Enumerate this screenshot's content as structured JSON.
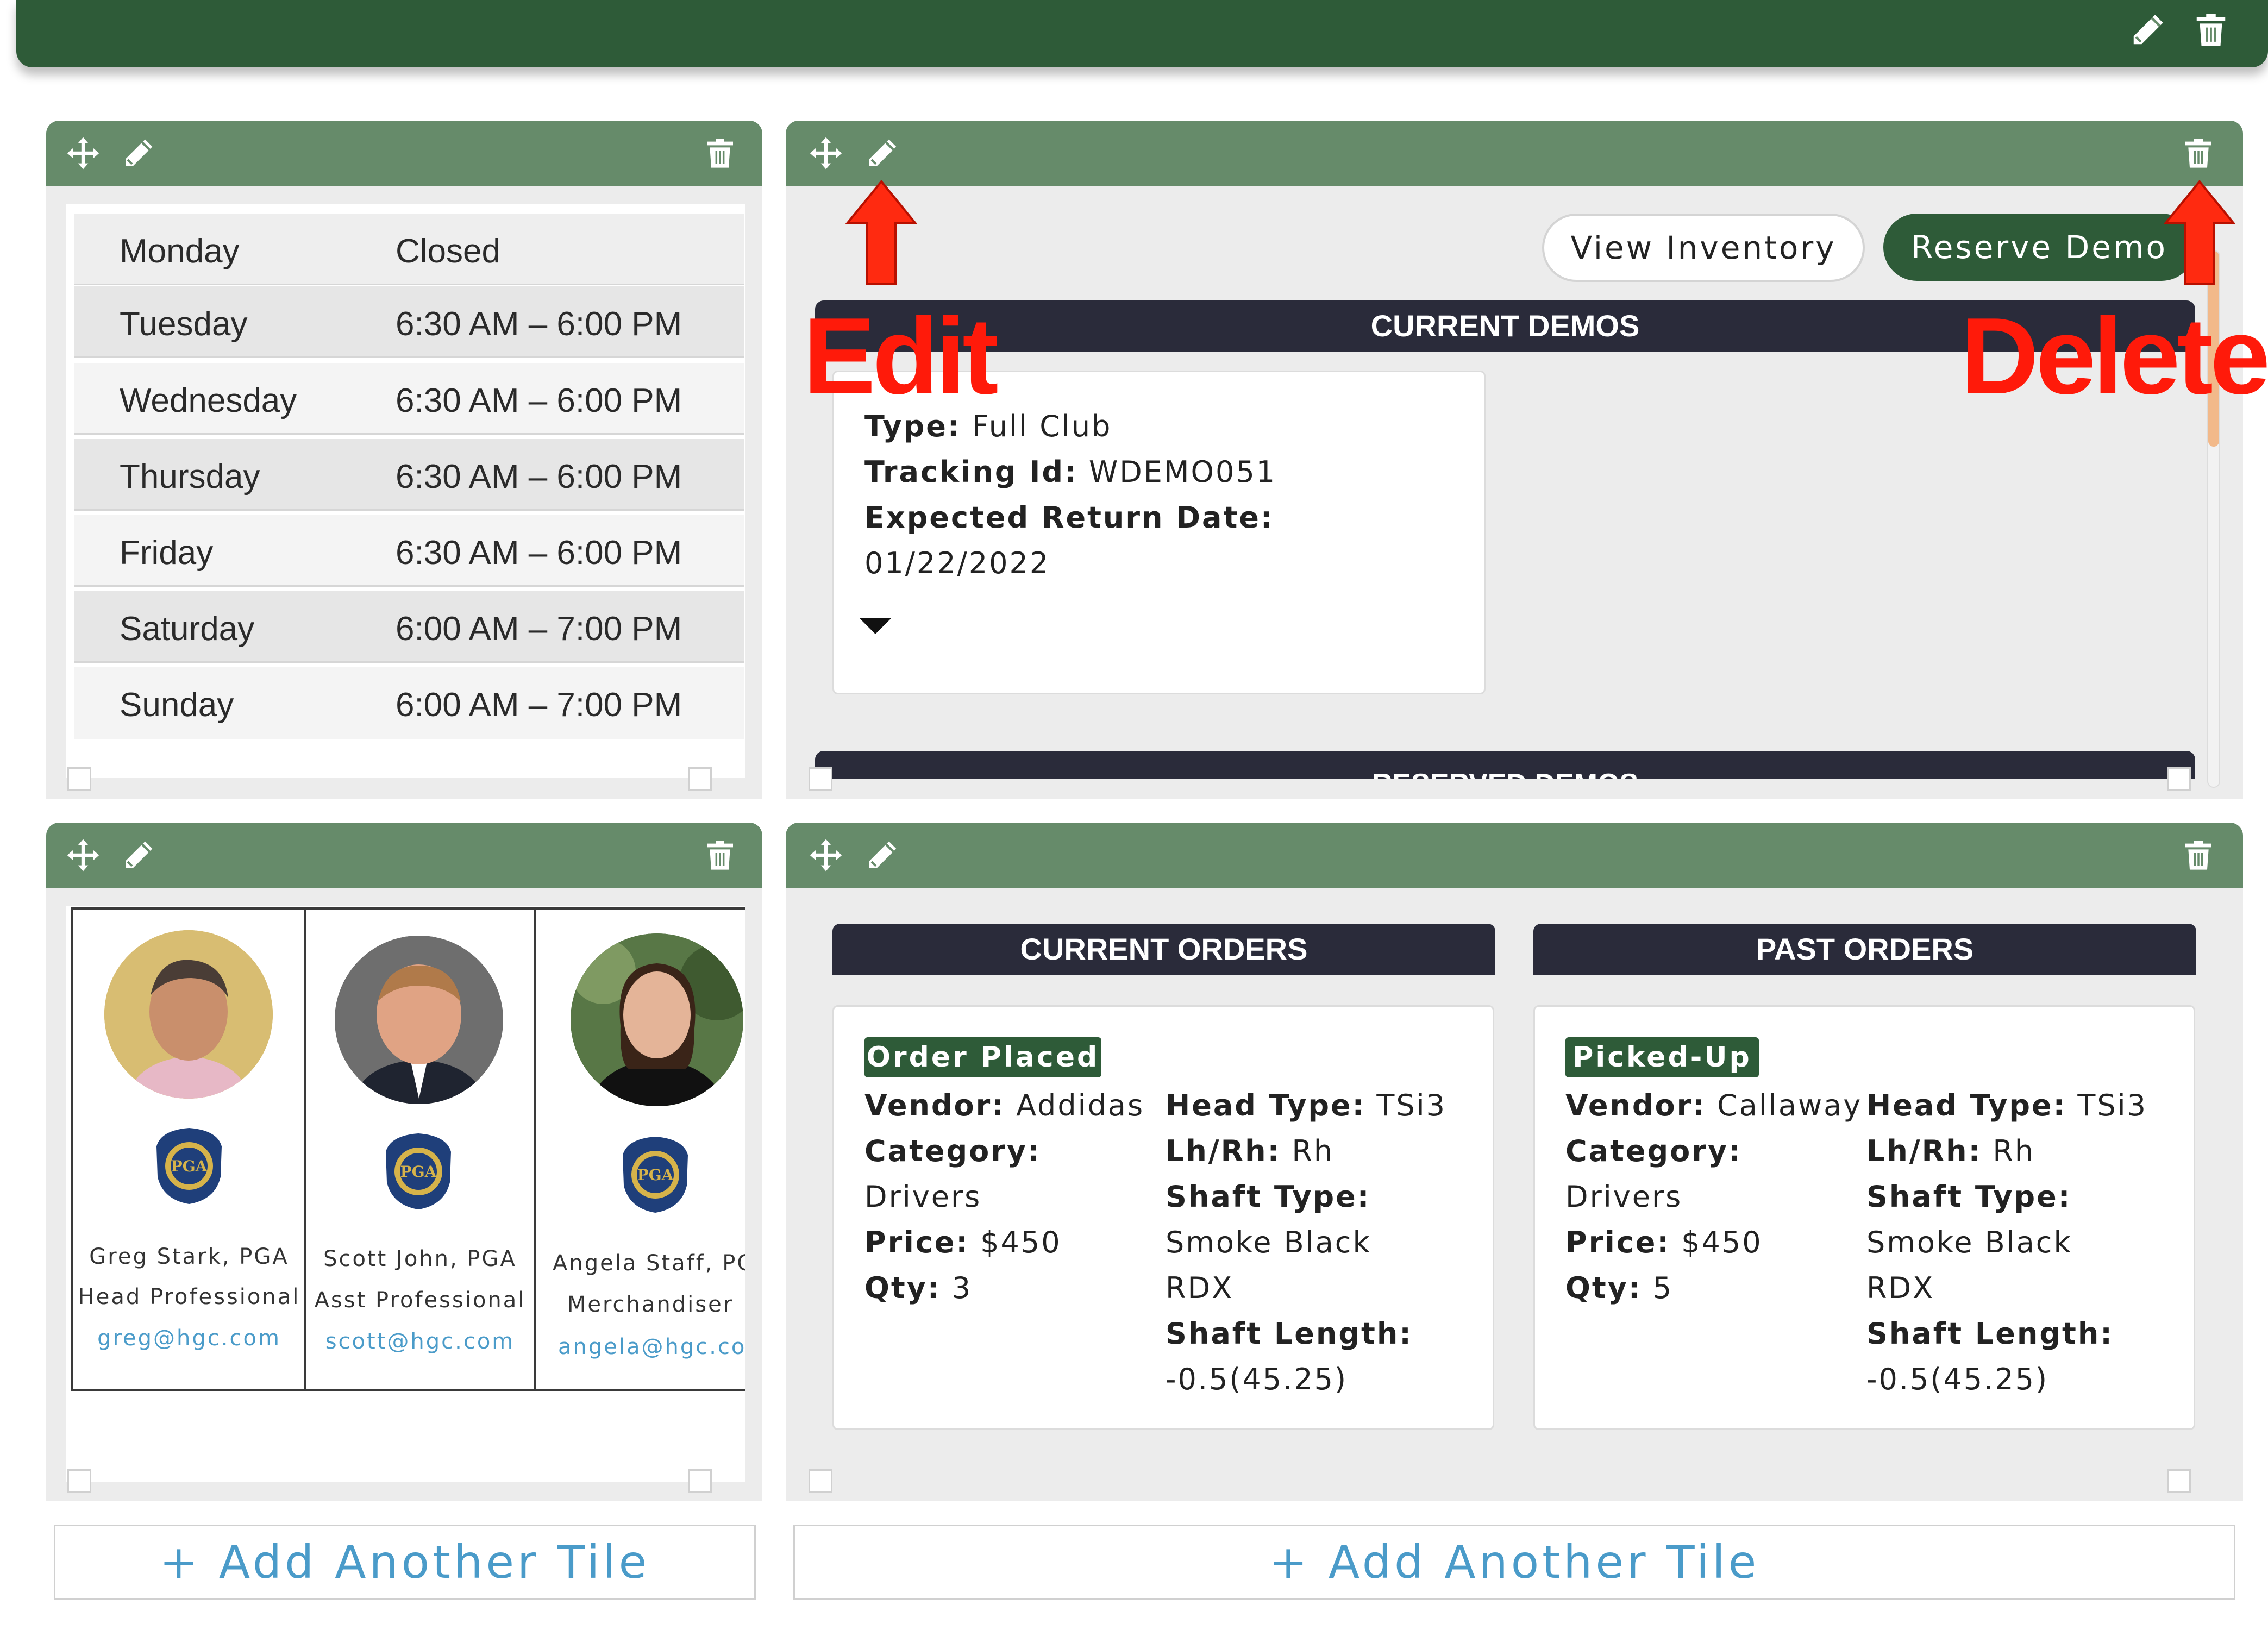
{
  "hours": [
    {
      "day": "Monday",
      "time": "Closed"
    },
    {
      "day": "Tuesday",
      "time": "6:30 AM – 6:00 PM"
    },
    {
      "day": "Wednesday",
      "time": "6:30 AM – 6:00 PM"
    },
    {
      "day": "Thursday",
      "time": "6:30 AM – 6:00 PM"
    },
    {
      "day": "Friday",
      "time": "6:30 AM – 6:00 PM"
    },
    {
      "day": "Saturday",
      "time": "6:00 AM – 7:00 PM"
    },
    {
      "day": "Sunday",
      "time": "6:00 AM – 7:00 PM"
    }
  ],
  "demos": {
    "view_inventory": "View Inventory",
    "reserve_demo": "Reserve Demo",
    "current_header": "CURRENT DEMOS",
    "reserved_header": "RESERVED DEMOS",
    "card": {
      "type_label": "Type:",
      "type_value": "Full Club",
      "tracking_label": "Tracking Id:",
      "tracking_value": "WDEMO051",
      "return_label": "Expected Return Date:",
      "return_value": "01/22/2022"
    }
  },
  "annotations": {
    "edit": "Edit",
    "delete": "Delete"
  },
  "staff": [
    {
      "name": "Greg Stark, PGA",
      "title": "Head Professional",
      "email": "greg@hgc.com"
    },
    {
      "name": "Scott John, PGA",
      "title": "Asst Professional",
      "email": "scott@hgc.com"
    },
    {
      "name": "Angela Staff, PGA",
      "title": "Merchandiser",
      "email": "angela@hgc.com"
    }
  ],
  "pga_logo_text": "PGA",
  "orders": {
    "current_header": "CURRENT ORDERS",
    "past_header": "PAST ORDERS",
    "labels": {
      "vendor": "Vendor:",
      "category": "Category:",
      "price": "Price:",
      "qty": "Qty:",
      "head_type": "Head Type:",
      "lhrh": "Lh/Rh:",
      "shaft_type": "Shaft Type:",
      "shaft_length": "Shaft Length:"
    },
    "current": {
      "status": "Order Placed",
      "vendor": "Addidas",
      "category": "Drivers",
      "price": "$450",
      "qty": "3",
      "head_type": "TSi3",
      "lhrh": "Rh",
      "shaft_type_1": "Smoke Black",
      "shaft_type_2": "RDX",
      "shaft_length": "-0.5(45.25)"
    },
    "past": {
      "status": "Picked-Up",
      "vendor": "Callaway",
      "category": "Drivers",
      "price": "$450",
      "qty": "5",
      "head_type": "TSi3",
      "lhrh": "Rh",
      "shaft_type_1": "Smoke Black",
      "shaft_type_2": "RDX",
      "shaft_length": "-0.5(45.25)"
    }
  },
  "add_tile_left": "+ Add Another Tile",
  "add_tile_right": "+ Add Another Tile",
  "colors": {
    "dark_green": "#2e5b38",
    "header_green": "#668b6a",
    "dark_bar": "#2a2b3a",
    "link_blue": "#4a9bc9",
    "annotation_red": "#ff1a0a"
  }
}
